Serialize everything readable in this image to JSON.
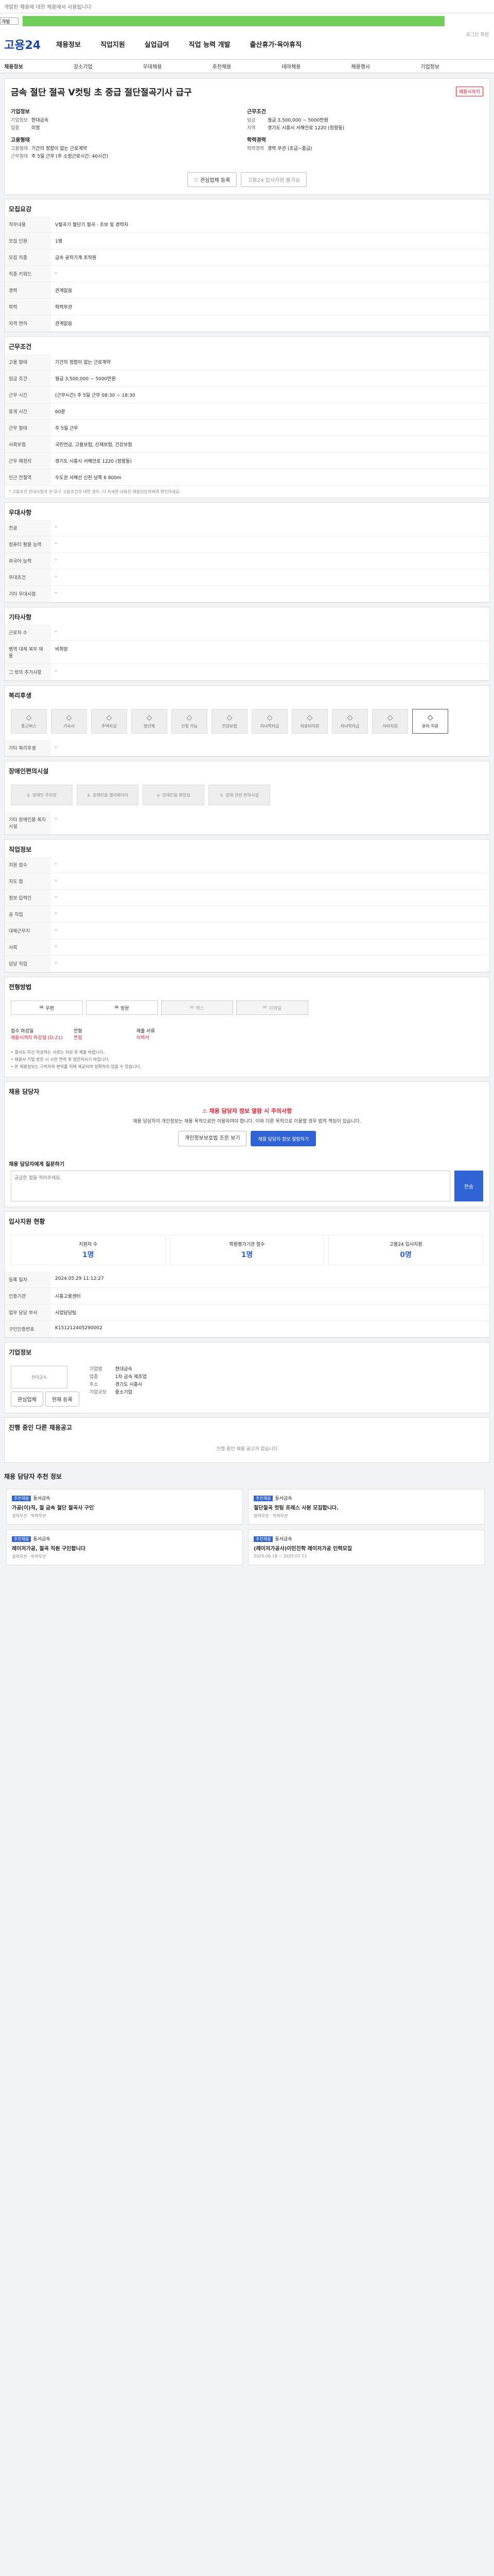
{
  "top": {
    "note": "개발된 채용에 대한 채용에서 사용됩니다",
    "select": "개발"
  },
  "header": {
    "logo": "고용24",
    "nav": [
      "채용정보",
      "직업지원",
      "실업급여",
      "직업 능력 개발",
      "출산휴가·육아휴직"
    ],
    "right": "로그인 회원"
  },
  "subnav": [
    "채용정보",
    "강소기업",
    "우대채용",
    "추천채용",
    "테마채용",
    "채용행사",
    "기업정보"
  ],
  "job": {
    "title": "금속 절단 절곡 V컷팅 초 중급 절단절곡기사 급구",
    "badge": "채용시까지",
    "company_label": "기업정보",
    "company_name": "현대금속",
    "rep_label": "업종",
    "rep_value": "미정",
    "cond_label": "근무조건",
    "pay_label": "임금",
    "pay_value": "월급 3,500,000 ~ 5000만원",
    "region_label": "지역",
    "region_value": "경기도 시흥시 서해안로 1220 (정왕동)",
    "emp_label": "고용형태",
    "emp_value": "기간의 정함이 없는 근로계약",
    "wt_label": "근무형태",
    "wt_value": "주 5일 근무 (주 소정근로시간: 40시간)",
    "career_label": "학력경력",
    "career_value": "경력 무관 (초급~중급)",
    "btn_left": "관심업체 등록",
    "btn_right": "고용24 입사지원 불가능"
  },
  "sections": {
    "recruit": "모집요강",
    "work": "근무조건",
    "pref": "우대사항",
    "etc": "기타사항",
    "welfare": "복리후생",
    "disability": "장애인편의시설",
    "place": "직업정보",
    "process": "전형방법",
    "contact": "채용 담당자",
    "apply_stats": "입사지원 현황",
    "company": "기업정보",
    "ongoing": "진행 중인 다른 채용공고",
    "recommend": "채용 담당자 추천 정보"
  },
  "recruit_rows": [
    {
      "k": "직무내용",
      "v": "V절곡기 절단기 절곡 · 초보 및 경력자"
    },
    {
      "k": "모집 인원",
      "v": "1명"
    },
    {
      "k": "모집 직종",
      "v": "금속 공작기계 조작원"
    },
    {
      "k": "직종 키워드",
      "v": "-"
    },
    {
      "k": "경력",
      "v": "관계없음"
    },
    {
      "k": "학력",
      "v": "학력무관"
    },
    {
      "k": "자격 면허",
      "v": "관계없음"
    }
  ],
  "work_rows": [
    {
      "k": "고용 형태",
      "v": "기간의 정함이 없는 근로계약"
    },
    {
      "k": "임금 조건",
      "v": "월급 3,500,000 ~ 5000만원"
    },
    {
      "k": "근무 시간",
      "v": "(근무시간) 주 5일 근무 08:30 ~ 18:30"
    },
    {
      "k": "휴게 시간",
      "v": "60분"
    },
    {
      "k": "근무 형태",
      "v": "주 5일 근무"
    },
    {
      "k": "사회보험",
      "v": "국민연금, 고용보험, 산재보험, 건강보험"
    },
    {
      "k": "근무 예정지",
      "v": "경기도 시흥시 서해안로 1220 (정왕동)"
    },
    {
      "k": "인근 전철역",
      "v": "수도권 서해선 신천 남쪽 6 800m"
    }
  ],
  "work_note": "* 고용조건 안내사항과 관 요구 고용조건과 대한 경우, 더 자세한 내용은 채용담당자에게 확인하세요.",
  "pref_rows": [
    {
      "k": "전공",
      "v": "-"
    },
    {
      "k": "컴퓨터 활용 능력",
      "v": "-"
    },
    {
      "k": "외국어 능력",
      "v": "-"
    },
    {
      "k": "우대조건",
      "v": "-"
    },
    {
      "k": "기타 우대사항",
      "v": "-"
    }
  ],
  "etc_rows": [
    {
      "k": "근로자 수",
      "v": "-"
    },
    {
      "k": "병역 대체 복무 채용",
      "v": "비희망"
    },
    {
      "k": "그 밖의 추가사항",
      "v": "-"
    }
  ],
  "welfare_items": [
    "통근버스",
    "기숙사",
    "주택자금",
    "정년제",
    "신청 가능",
    "건강보험",
    "자녀학자금",
    "의료비지원",
    "자녀학자금",
    "식비지원",
    "유아 지원"
  ],
  "welfare_note_label": "기타 복리후생",
  "disability_items": [
    "장애인 주차장",
    "장애인용 엘리베이터",
    "장애인용 화장실",
    "장애 관련 편의시설"
  ],
  "disability_note_label": "기타 장애인용 복지시설",
  "place_rows": [
    {
      "k": "지원 접수",
      "v": "-"
    },
    {
      "k": "지도 형",
      "v": "-"
    },
    {
      "k": "정보 입력인",
      "v": "-"
    },
    {
      "k": "공 직업",
      "v": "-"
    }
  ],
  "place_rows_right": [
    {
      "k": "대체근무지",
      "v": "-"
    },
    {
      "k": "사회",
      "v": "-"
    },
    {
      "k": "담당 직업",
      "v": "-"
    }
  ],
  "methods": [
    "우편",
    "방문",
    "팩스",
    "이메일"
  ],
  "process_steps": [
    {
      "label": "접수 마감일",
      "val": "채용시까지 마감일 (D-21)"
    },
    {
      "label": "전형",
      "val": "면접"
    },
    {
      "label": "제출 서류",
      "val": "이력서"
    }
  ],
  "process_bullets": [
    "• 결시도 미신 작성하는 서류는 지원 후 제출 바랍니다.",
    "• 채용서 기업 방문 시 사전 연락 후 방문하시기 바랍니다.",
    "• 본 채용정보는 구직자의 편의를 위해 제공되며 정확하지 않을 수 있습니다."
  ],
  "contact": {
    "head": "채용 담당자 정보 열람 시 주의사항",
    "body": "채용 담당자의 개인정보는 채용 목적으로만 이용하여야 합니다. 이와 다른 목적으로 이용할 경우 법적 책임이 있습니다.",
    "btn1": "개인정보보호법 조문 보기",
    "btn2": "채용 담당자 정보 열람하기",
    "qa_label": "채용 담당자에게 질문하기",
    "qa_placeholder": "궁금한 점을 적어주세요.",
    "send": "전송"
  },
  "apply_stats": [
    {
      "k": "지원자 수",
      "n": "1명"
    },
    {
      "k": "학원평가기관 점수",
      "n": "1명"
    },
    {
      "k": "고용24 입사지원",
      "n": "0명"
    }
  ],
  "info_rows": [
    {
      "k": "등록 일자",
      "v": "2024.05.29 11:12:27"
    },
    {
      "k": "인증기관",
      "v": "시흥고용센터"
    },
    {
      "k": "업무 담당 부서",
      "v": "사업담당팀"
    },
    {
      "k": "구인인증번호",
      "v": "K151212405290002"
    }
  ],
  "company": {
    "logo_text": "현대금속",
    "btn1": "관심업체",
    "btn2": "현재 등록",
    "fields": [
      {
        "k": "기업명",
        "v": "현대금속"
      },
      {
        "k": "업종",
        "v": "1차 금속 제조업"
      },
      {
        "k": "주소",
        "v": "경기도 시흥시"
      },
      {
        "k": "기업규모",
        "v": "중소기업"
      }
    ]
  },
  "ongoing_empty": "진행 중인 채용 공고가 없습니다",
  "recommend": [
    {
      "tag": "추천채용",
      "co": "동서금속",
      "title": "가공(이)직, 절 금속 절단 절곡사 구인",
      "meta": "경력무관 · 학력무관"
    },
    {
      "tag": "추천채용",
      "co": "동서금속",
      "title": "절단절곡 컷팅 프레스 사원 모집합니다.",
      "meta": "경력무관 · 학력무관"
    },
    {
      "tag": "추천채용",
      "co": "동서금속",
      "title": "레이저가공, 절곡 직원 구인합니다",
      "meta": "경력무관 · 학력무관"
    },
    {
      "tag": "추천채용",
      "co": "동서금속",
      "title": "(레이저가공사)이민진학 레이저가공 인력모집",
      "meta": "2025.06.18 ~ 2025.07.11"
    }
  ]
}
